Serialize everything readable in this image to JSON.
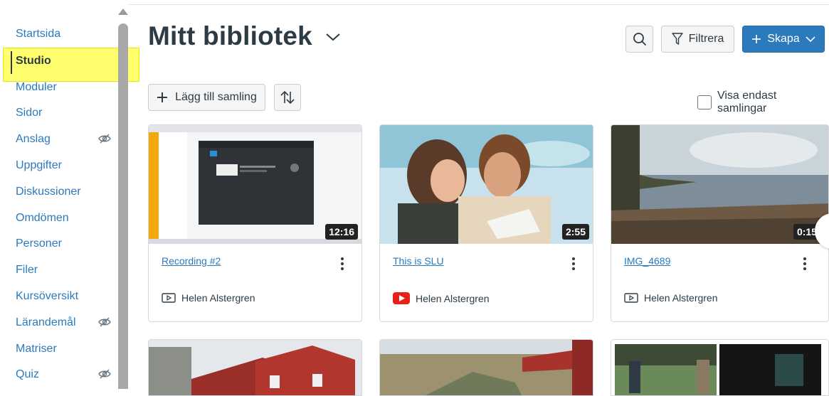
{
  "sidebar": {
    "items": [
      {
        "label": "Startsida"
      },
      {
        "label": "Studio"
      },
      {
        "label": "Moduler"
      },
      {
        "label": "Sidor"
      },
      {
        "label": "Anslag"
      },
      {
        "label": "Uppgifter"
      },
      {
        "label": "Diskussioner"
      },
      {
        "label": "Omdömen"
      },
      {
        "label": "Personer"
      },
      {
        "label": "Filer"
      },
      {
        "label": "Kursöversikt"
      },
      {
        "label": "Lärandemål"
      },
      {
        "label": "Matriser"
      },
      {
        "label": "Quiz"
      }
    ],
    "active": "Studio",
    "hidden_icon": "eye-slash-icon"
  },
  "header": {
    "title": "Mitt bibliotek",
    "filter_label": "Filtrera",
    "create_label": "Skapa"
  },
  "toolbar": {
    "add_collection_label": "Lägg till samling",
    "only_collections_label": "Visa endast samlingar",
    "only_collections_checked": false
  },
  "cards": [
    {
      "title": "Recording #2",
      "duration": "12:16",
      "owner": "Helen Alstergren",
      "source_icon": "video-icon"
    },
    {
      "title": "This is SLU",
      "duration": "2:55",
      "owner": "Helen Alstergren",
      "source_icon": "youtube-icon"
    },
    {
      "title": "IMG_4689",
      "duration": "0:15",
      "owner": "Helen Alstergren",
      "source_icon": "video-icon"
    }
  ],
  "colors": {
    "link": "#2b7abc",
    "text": "#2d3b45",
    "primary": "#2b7abc",
    "highlight": "#ffff66",
    "youtube": "#e62117"
  }
}
